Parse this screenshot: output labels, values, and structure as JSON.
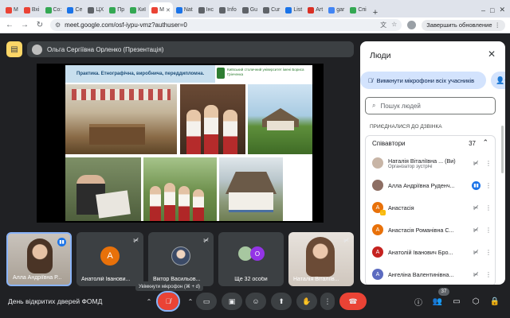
{
  "browser": {
    "tabs": [
      {
        "label": "M",
        "color": "#ea4335"
      },
      {
        "label": "Вхі",
        "color": "#ea4335"
      },
      {
        "label": "Co:",
        "color": "#34a853"
      },
      {
        "label": "Се",
        "color": "#1a73e8"
      },
      {
        "label": "ЦХ",
        "color": "#5f6368"
      },
      {
        "label": "Пр",
        "color": "#34a853"
      },
      {
        "label": "Киї",
        "color": "#34a853"
      },
      {
        "label": "M",
        "color": "#ea4335",
        "active": true
      },
      {
        "label": "Nat",
        "color": "#1a73e8"
      },
      {
        "label": "Інс",
        "color": "#5f6368"
      },
      {
        "label": "Info",
        "color": "#5f6368"
      },
      {
        "label": "Gu",
        "color": "#5f6368"
      },
      {
        "label": "Cur",
        "color": "#5f6368"
      },
      {
        "label": "List",
        "color": "#1a73e8"
      },
      {
        "label": "Art",
        "color": "#d93025"
      },
      {
        "label": "gar",
        "color": "#4285f4"
      },
      {
        "label": "Спі",
        "color": "#34a853"
      }
    ],
    "url": "meet.google.com/osf-iypu-vmz?authuser=0",
    "update_label": "Завершить обновление"
  },
  "meet": {
    "presenter_label": "Ольга Сергіївна Орленко (Презентація)",
    "slide": {
      "banner": "Практика. Етнографічна, виробнича, переддипломна.",
      "university": "Київський столичний університет імені Бориса Грінченка"
    },
    "tiles": [
      {
        "name": "Алла Андріївна Р..."
      },
      {
        "name": "Анатолій Іванови...",
        "initial": "А"
      },
      {
        "name": "Віктор Васильов..."
      },
      {
        "name": "Ще 32 особи",
        "initial": "O"
      },
      {
        "name": "Наталія Віталіїв..."
      }
    ],
    "tooltip": "Увімкнути мікрофон (⌘ + d)",
    "meeting_name": "День відкритих дверей ФОМД",
    "participants_count": "37"
  },
  "people_panel": {
    "title": "Люди",
    "mute_all_label": "Вимкнути мікрофони всіх учасників",
    "search_placeholder": "Пошук людей",
    "section_label": "ПРИЄДНАЛИСЯ ДО ДЗВІНКА",
    "group_label": "Співавтори",
    "group_count": "37",
    "participants": [
      {
        "name": "Наталія Віталіївна ... (Ви)",
        "role": "Організатор зустрічі",
        "avatar": "photo",
        "color": "#c8b5a6"
      },
      {
        "name": "Алла Андріївна Руденч...",
        "avatar": "photo",
        "color": "#8d6e63",
        "speaking": true
      },
      {
        "name": "Анастасія",
        "initial": "А",
        "color": "#e8710a",
        "hand": true
      },
      {
        "name": "Анастасія Романівна С...",
        "initial": "А",
        "color": "#e8710a"
      },
      {
        "name": "Анатолій Іванович Бро...",
        "initial": "А",
        "color": "#c5221f"
      },
      {
        "name": "Ангеліна Валентинівна...",
        "initial": "А",
        "color": "#5c6bc0"
      }
    ]
  }
}
